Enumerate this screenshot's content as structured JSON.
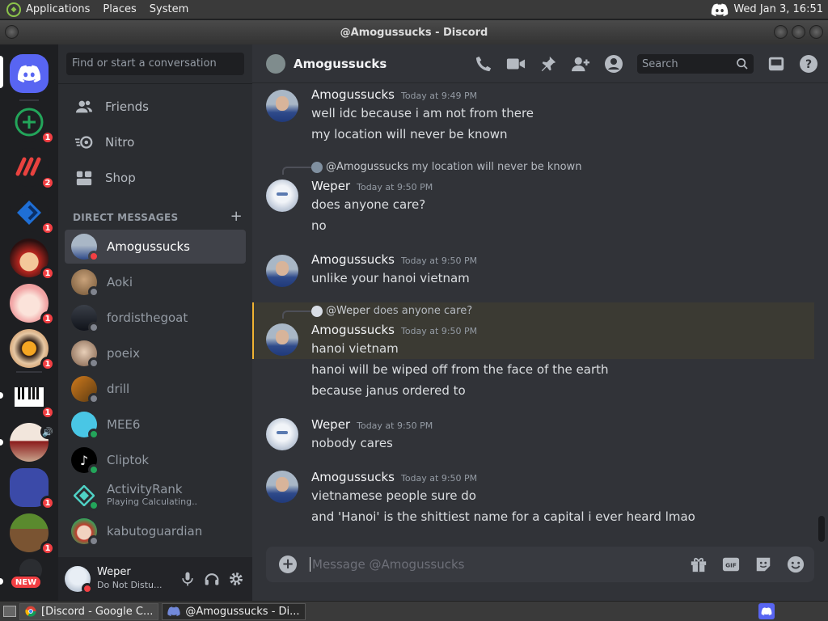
{
  "system_panel": {
    "menus": [
      "Applications",
      "Places",
      "System"
    ],
    "clock": "Wed Jan 3, 16:51"
  },
  "window": {
    "title": "@Amogussucks - Discord"
  },
  "servers": [
    {
      "name": "home",
      "icon": "discord-logo-icon",
      "badge": null
    },
    {
      "name": "server-1",
      "icon": "add-circle-icon",
      "badge": "1"
    },
    {
      "name": "server-2",
      "icon": "red-logo-icon",
      "badge": "2"
    },
    {
      "name": "server-3",
      "icon": "blue-diamond-icon",
      "badge": "1"
    },
    {
      "name": "server-4",
      "icon": "anime-avatar-icon",
      "badge": "1"
    },
    {
      "name": "server-5",
      "icon": "anime-girl-icon",
      "badge": "1"
    },
    {
      "name": "server-6",
      "icon": "headphone-avatar-icon",
      "badge": "1"
    },
    {
      "name": "server-7",
      "icon": "piano-icon",
      "badge": "1"
    },
    {
      "name": "server-8",
      "icon": "pokeball-icon",
      "badge": null
    },
    {
      "name": "server-9",
      "icon": "folder-icon",
      "badge": "1"
    },
    {
      "name": "server-10",
      "icon": "minecraft-icon",
      "badge": "1"
    },
    {
      "name": "server-11",
      "icon": "new-server-icon",
      "badge": "NEW"
    }
  ],
  "dm_sidebar": {
    "search_placeholder": "Find or start a conversation",
    "nav": [
      {
        "label": "Friends",
        "icon": "friends-icon"
      },
      {
        "label": "Nitro",
        "icon": "nitro-icon"
      },
      {
        "label": "Shop",
        "icon": "shop-icon"
      }
    ],
    "dm_header": "DIRECT MESSAGES",
    "dm_add": "+",
    "dms": [
      {
        "name": "Amogussucks",
        "status": "dnd",
        "active": true
      },
      {
        "name": "Aoki",
        "status": "offline"
      },
      {
        "name": "fordisthegoat",
        "status": "offline"
      },
      {
        "name": "poeix",
        "status": "offline"
      },
      {
        "name": "drill",
        "status": "offline"
      },
      {
        "name": "MEE6",
        "status": "online"
      },
      {
        "name": "Cliptok",
        "status": "online"
      },
      {
        "name": "ActivityRank",
        "sub": "Playing Calculating..",
        "status": "online"
      },
      {
        "name": "kabutoguardian",
        "status": "offline"
      }
    ]
  },
  "user_panel": {
    "name": "Weper",
    "status": "Do Not Distu..."
  },
  "chat": {
    "title": "Amogussucks",
    "search_placeholder": "Search",
    "messages": [
      {
        "author": "Amogussucks",
        "time": "Today at 9:49 PM",
        "lines": [
          "well idc because i am not from there",
          "my location will never be known"
        ]
      },
      {
        "author": "Weper",
        "time": "Today at 9:50 PM",
        "reply_to": "@Amogussucks",
        "reply_text": "my location will never be known",
        "lines": [
          "does anyone care?",
          "no"
        ]
      },
      {
        "author": "Amogussucks",
        "time": "Today at 9:50 PM",
        "lines": [
          "unlike your hanoi vietnam"
        ]
      },
      {
        "author": "Amogussucks",
        "time": "Today at 9:50 PM",
        "reply_to": "@Weper",
        "reply_text": "does anyone care?",
        "lines": [
          "hanoi vietnam",
          "hanoi will be wiped off from the face of the earth",
          "because janus ordered to"
        ]
      },
      {
        "author": "Weper",
        "time": "Today at 9:50 PM",
        "lines": [
          "nobody cares"
        ]
      },
      {
        "author": "Amogussucks",
        "time": "Today at 9:50 PM",
        "lines": [
          "vietnamese people sure do",
          "and 'Hanoi' is the shittiest name for a capital i ever heard lmao"
        ]
      }
    ],
    "composer_placeholder": "Message @Amogussucks"
  },
  "taskbar": {
    "tasks": [
      {
        "label": "[Discord - Google C...",
        "icon": "chrome-icon",
        "active": false
      },
      {
        "label": "@Amogussucks - Di...",
        "icon": "discord-icon",
        "active": true
      }
    ]
  },
  "colors": {
    "accent": "#5865f2",
    "dnd": "#f23f43",
    "online": "#23a55a",
    "mention_bg": "#3b3a33",
    "mention_bar": "#f0b232"
  }
}
